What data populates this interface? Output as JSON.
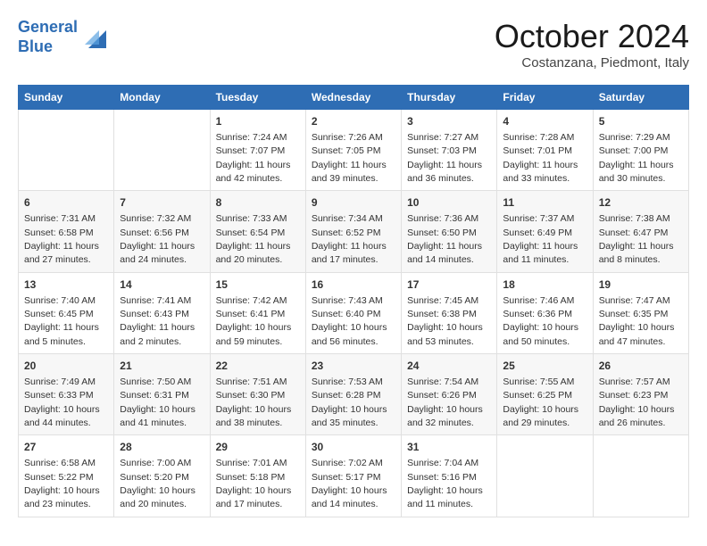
{
  "logo": {
    "line1": "General",
    "line2": "Blue"
  },
  "header": {
    "month": "October 2024",
    "location": "Costanzana, Piedmont, Italy"
  },
  "weekdays": [
    "Sunday",
    "Monday",
    "Tuesday",
    "Wednesday",
    "Thursday",
    "Friday",
    "Saturday"
  ],
  "weeks": [
    [
      {
        "day": null
      },
      {
        "day": null
      },
      {
        "day": 1,
        "sunrise": "7:24 AM",
        "sunset": "7:07 PM",
        "daylight": "11 hours and 42 minutes."
      },
      {
        "day": 2,
        "sunrise": "7:26 AM",
        "sunset": "7:05 PM",
        "daylight": "11 hours and 39 minutes."
      },
      {
        "day": 3,
        "sunrise": "7:27 AM",
        "sunset": "7:03 PM",
        "daylight": "11 hours and 36 minutes."
      },
      {
        "day": 4,
        "sunrise": "7:28 AM",
        "sunset": "7:01 PM",
        "daylight": "11 hours and 33 minutes."
      },
      {
        "day": 5,
        "sunrise": "7:29 AM",
        "sunset": "7:00 PM",
        "daylight": "11 hours and 30 minutes."
      }
    ],
    [
      {
        "day": 6,
        "sunrise": "7:31 AM",
        "sunset": "6:58 PM",
        "daylight": "11 hours and 27 minutes."
      },
      {
        "day": 7,
        "sunrise": "7:32 AM",
        "sunset": "6:56 PM",
        "daylight": "11 hours and 24 minutes."
      },
      {
        "day": 8,
        "sunrise": "7:33 AM",
        "sunset": "6:54 PM",
        "daylight": "11 hours and 20 minutes."
      },
      {
        "day": 9,
        "sunrise": "7:34 AM",
        "sunset": "6:52 PM",
        "daylight": "11 hours and 17 minutes."
      },
      {
        "day": 10,
        "sunrise": "7:36 AM",
        "sunset": "6:50 PM",
        "daylight": "11 hours and 14 minutes."
      },
      {
        "day": 11,
        "sunrise": "7:37 AM",
        "sunset": "6:49 PM",
        "daylight": "11 hours and 11 minutes."
      },
      {
        "day": 12,
        "sunrise": "7:38 AM",
        "sunset": "6:47 PM",
        "daylight": "11 hours and 8 minutes."
      }
    ],
    [
      {
        "day": 13,
        "sunrise": "7:40 AM",
        "sunset": "6:45 PM",
        "daylight": "11 hours and 5 minutes."
      },
      {
        "day": 14,
        "sunrise": "7:41 AM",
        "sunset": "6:43 PM",
        "daylight": "11 hours and 2 minutes."
      },
      {
        "day": 15,
        "sunrise": "7:42 AM",
        "sunset": "6:41 PM",
        "daylight": "10 hours and 59 minutes."
      },
      {
        "day": 16,
        "sunrise": "7:43 AM",
        "sunset": "6:40 PM",
        "daylight": "10 hours and 56 minutes."
      },
      {
        "day": 17,
        "sunrise": "7:45 AM",
        "sunset": "6:38 PM",
        "daylight": "10 hours and 53 minutes."
      },
      {
        "day": 18,
        "sunrise": "7:46 AM",
        "sunset": "6:36 PM",
        "daylight": "10 hours and 50 minutes."
      },
      {
        "day": 19,
        "sunrise": "7:47 AM",
        "sunset": "6:35 PM",
        "daylight": "10 hours and 47 minutes."
      }
    ],
    [
      {
        "day": 20,
        "sunrise": "7:49 AM",
        "sunset": "6:33 PM",
        "daylight": "10 hours and 44 minutes."
      },
      {
        "day": 21,
        "sunrise": "7:50 AM",
        "sunset": "6:31 PM",
        "daylight": "10 hours and 41 minutes."
      },
      {
        "day": 22,
        "sunrise": "7:51 AM",
        "sunset": "6:30 PM",
        "daylight": "10 hours and 38 minutes."
      },
      {
        "day": 23,
        "sunrise": "7:53 AM",
        "sunset": "6:28 PM",
        "daylight": "10 hours and 35 minutes."
      },
      {
        "day": 24,
        "sunrise": "7:54 AM",
        "sunset": "6:26 PM",
        "daylight": "10 hours and 32 minutes."
      },
      {
        "day": 25,
        "sunrise": "7:55 AM",
        "sunset": "6:25 PM",
        "daylight": "10 hours and 29 minutes."
      },
      {
        "day": 26,
        "sunrise": "7:57 AM",
        "sunset": "6:23 PM",
        "daylight": "10 hours and 26 minutes."
      }
    ],
    [
      {
        "day": 27,
        "sunrise": "6:58 AM",
        "sunset": "5:22 PM",
        "daylight": "10 hours and 23 minutes."
      },
      {
        "day": 28,
        "sunrise": "7:00 AM",
        "sunset": "5:20 PM",
        "daylight": "10 hours and 20 minutes."
      },
      {
        "day": 29,
        "sunrise": "7:01 AM",
        "sunset": "5:18 PM",
        "daylight": "10 hours and 17 minutes."
      },
      {
        "day": 30,
        "sunrise": "7:02 AM",
        "sunset": "5:17 PM",
        "daylight": "10 hours and 14 minutes."
      },
      {
        "day": 31,
        "sunrise": "7:04 AM",
        "sunset": "5:16 PM",
        "daylight": "10 hours and 11 minutes."
      },
      {
        "day": null
      },
      {
        "day": null
      }
    ]
  ],
  "labels": {
    "sunrise": "Sunrise:",
    "sunset": "Sunset:",
    "daylight": "Daylight:"
  }
}
